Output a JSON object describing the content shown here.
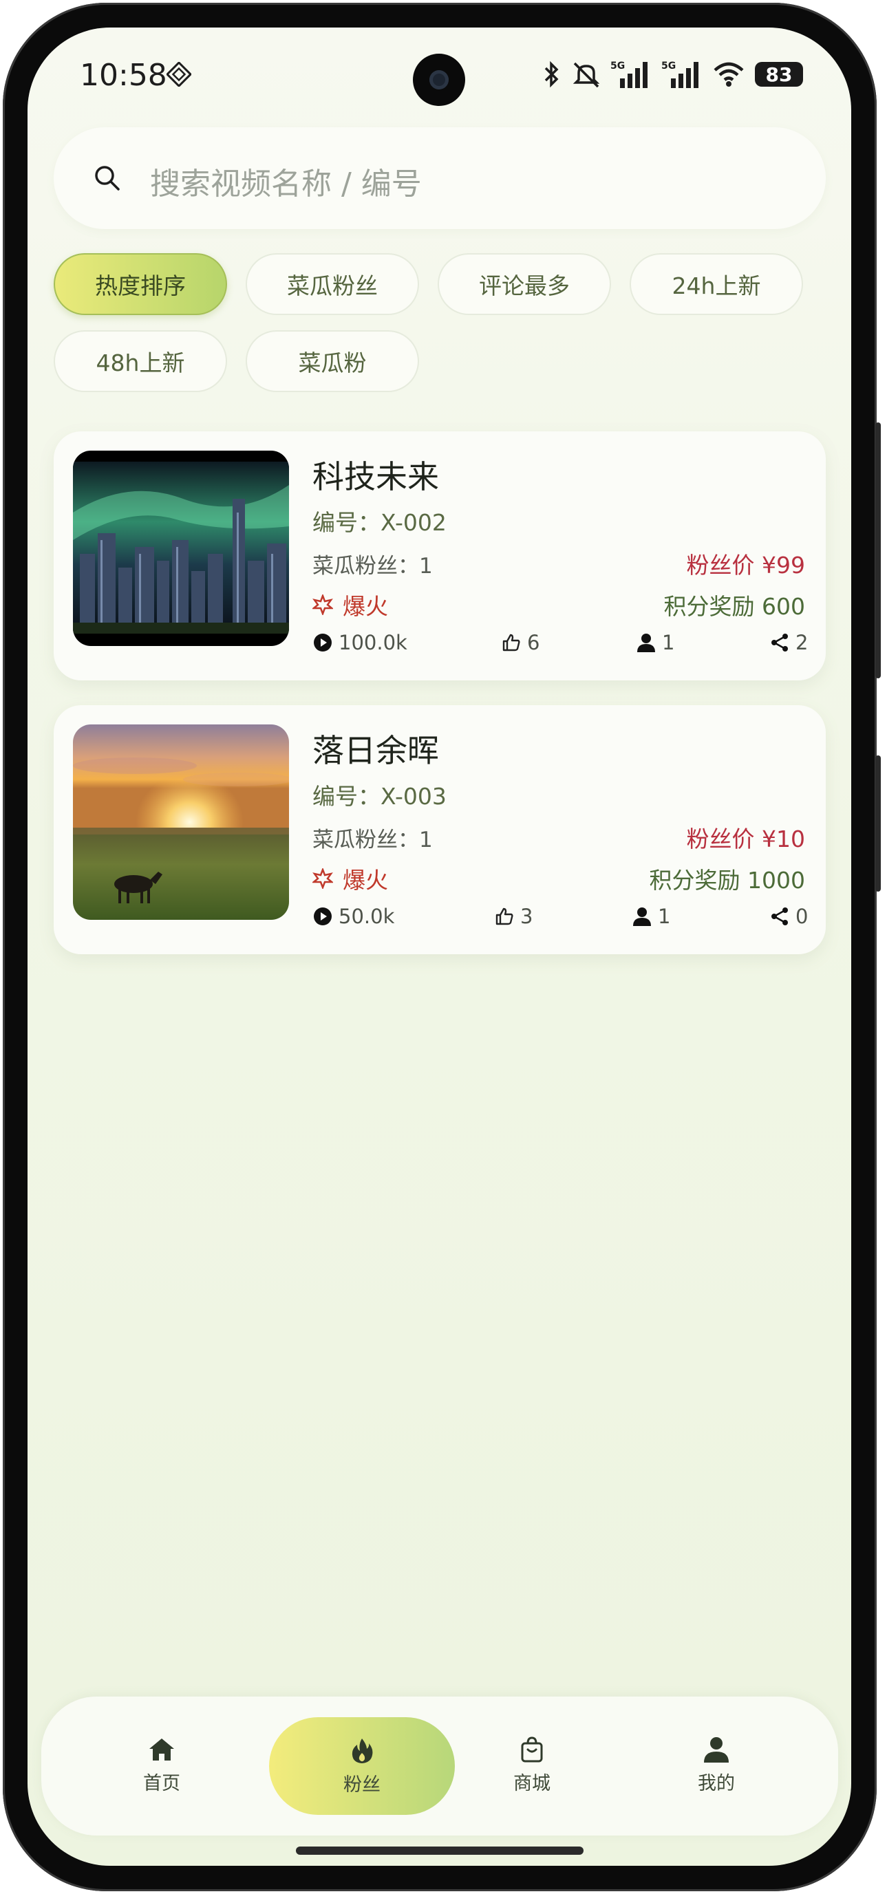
{
  "status_bar": {
    "time": "10:58",
    "battery": "83"
  },
  "search": {
    "placeholder": "搜索视频名称 / 编号"
  },
  "filters": [
    {
      "label": "热度排序",
      "active": true
    },
    {
      "label": "菜瓜粉丝",
      "active": false
    },
    {
      "label": "评论最多",
      "active": false
    },
    {
      "label": "24h上新",
      "active": false
    },
    {
      "label": "48h上新",
      "active": false
    },
    {
      "label": "菜瓜粉",
      "active": false
    }
  ],
  "videos": [
    {
      "title": "科技未来",
      "code": "编号：X-002",
      "fans": "菜瓜粉丝：1",
      "hot_label": "爆火",
      "price": "粉丝价 ¥99",
      "reward": "积分奖励 600",
      "plays": "100.0k",
      "likes": "6",
      "users": "1",
      "shares": "2"
    },
    {
      "title": "落日余晖",
      "code": "编号：X-003",
      "fans": "菜瓜粉丝：1",
      "hot_label": "爆火",
      "price": "粉丝价 ¥10",
      "reward": "积分奖励 1000",
      "plays": "50.0k",
      "likes": "3",
      "users": "1",
      "shares": "0"
    }
  ],
  "bottom_nav": [
    {
      "label": "首页",
      "icon": "home-icon",
      "active": false
    },
    {
      "label": "粉丝",
      "icon": "flame-icon",
      "active": true
    },
    {
      "label": "商城",
      "icon": "shopping-bag-icon",
      "active": false
    },
    {
      "label": "我的",
      "icon": "person-icon",
      "active": false
    }
  ],
  "colors": {
    "accent_start": "#f3ec7c",
    "accent_end": "#b7d77a",
    "price": "#b8303f",
    "hot": "#c0392b",
    "reward": "#4c6b38"
  }
}
